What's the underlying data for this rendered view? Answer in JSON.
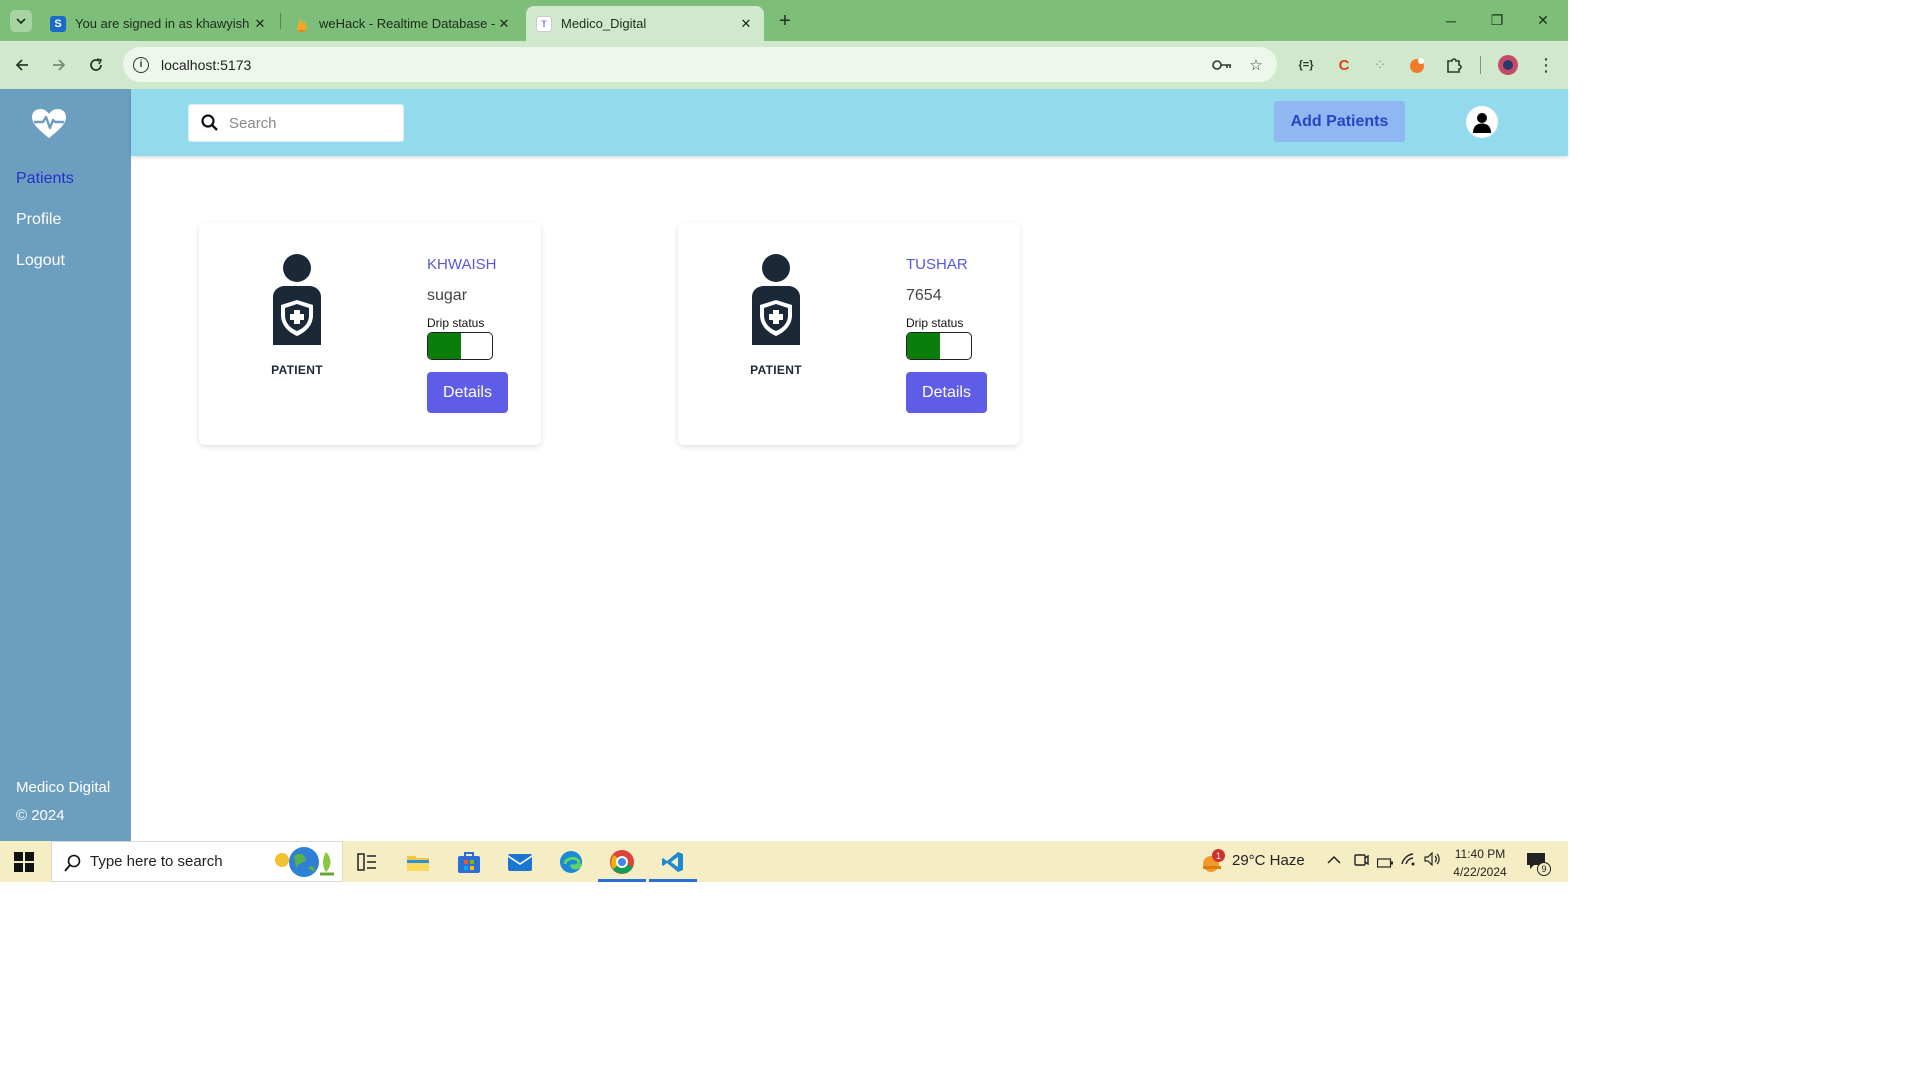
{
  "browser": {
    "tabs": [
      {
        "title": "You are signed in as khawyish",
        "favicon": "S"
      },
      {
        "title": "weHack - Realtime Database -",
        "favicon": ""
      },
      {
        "title": "Medico_Digital",
        "favicon": "T"
      }
    ],
    "url": "localhost:5173"
  },
  "sidebar": {
    "items": [
      {
        "label": "Patients",
        "active": true
      },
      {
        "label": "Profile",
        "active": false
      },
      {
        "label": "Logout",
        "active": false
      }
    ],
    "footer_line1": "Medico Digital",
    "footer_line2": "© 2024"
  },
  "header": {
    "search_placeholder": "Search",
    "add_button": "Add Patients"
  },
  "patients": [
    {
      "name": "KHWAISH",
      "condition": "sugar",
      "drip_label": "Drip status",
      "drip_on": true,
      "image_label": "PATIENT",
      "details_label": "Details"
    },
    {
      "name": "TUSHAR",
      "condition": "7654",
      "drip_label": "Drip status",
      "drip_on": true,
      "image_label": "PATIENT",
      "details_label": "Details"
    }
  ],
  "taskbar": {
    "search_placeholder": "Type here to search",
    "weather": "29°C  Haze",
    "weather_badge": "1",
    "time": "11:40 PM",
    "date": "4/22/2024",
    "notifications": "9"
  },
  "colors": {
    "sidebar": "#6c9ebf",
    "topbar": "#93dbec",
    "accent": "#5f5de8",
    "drip_on": "#0b7d0b"
  }
}
